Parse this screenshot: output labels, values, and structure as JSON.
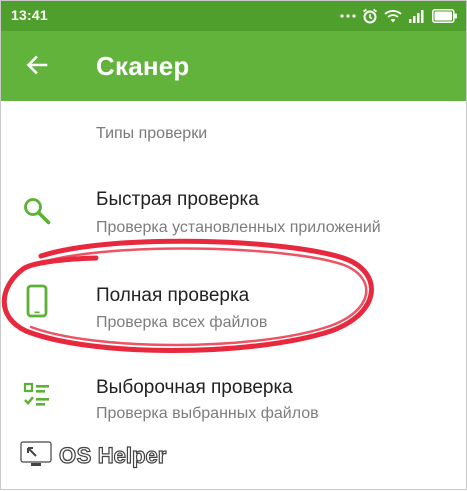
{
  "status_bar": {
    "time": "13:41",
    "icons": [
      "dots-icon",
      "alarm-icon",
      "wifi-icon",
      "signal-icon",
      "battery-icon"
    ]
  },
  "app_bar": {
    "title": "Сканер",
    "back_icon": "arrow-left-icon"
  },
  "section": {
    "header": "Типы проверки"
  },
  "items": [
    {
      "title": "Быстрая проверка",
      "subtitle": "Проверка установленных приложений",
      "icon": "search-icon"
    },
    {
      "title": "Полная проверка",
      "subtitle": "Проверка всех файлов",
      "icon": "phone-icon"
    },
    {
      "title": "Выборочная проверка",
      "subtitle": "Проверка выбранных файлов",
      "icon": "checklist-icon"
    }
  ],
  "watermark": {
    "part1": "OS",
    "part2": "Helper"
  },
  "colors": {
    "status_bar": "#4f9f2c",
    "app_bar": "#61b33c",
    "accent_icon": "#5cb036",
    "highlight": "#e8283d"
  }
}
